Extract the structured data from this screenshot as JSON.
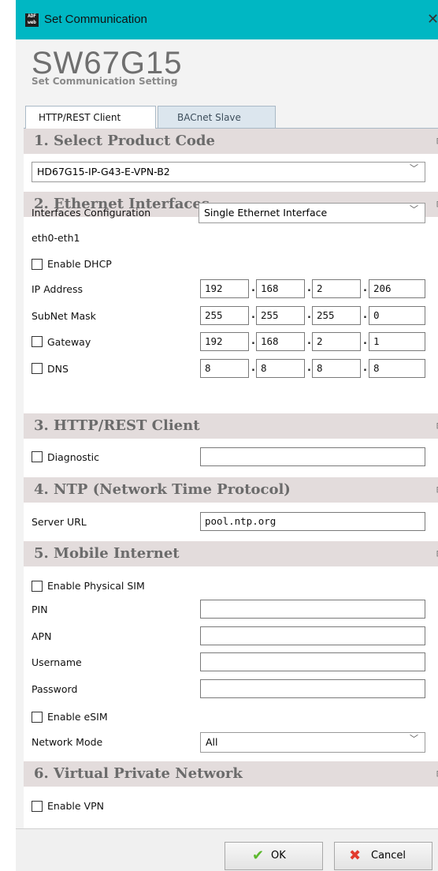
{
  "window": {
    "title": "Set Communication",
    "close_glyph": "✕",
    "app_icon": "ADF web"
  },
  "header": {
    "product_name": "SW67G15",
    "subtitle": "Set Communication Setting"
  },
  "tabs": [
    {
      "label": "HTTP/REST Client",
      "active": true
    },
    {
      "label": "BACnet Slave",
      "active": false
    }
  ],
  "sections": {
    "product_code": {
      "title": "1. Select Product Code",
      "selected": "HD67G15-IP-G43-E-VPN-B2"
    },
    "ethernet": {
      "title": "2. Ethernet Interfaces",
      "interfaces_label": "Interfaces Configuration",
      "interfaces_value": "Single Ethernet Interface",
      "group_label": "eth0-eth1",
      "dhcp_label": "Enable DHCP",
      "dhcp_checked": false,
      "ip_label": "IP Address",
      "ip": [
        "192",
        "168",
        "2",
        "206"
      ],
      "mask_label": "SubNet Mask",
      "mask": [
        "255",
        "255",
        "255",
        "0"
      ],
      "gateway_label": "Gateway",
      "gateway_checked": false,
      "gateway": [
        "192",
        "168",
        "2",
        "1"
      ],
      "dns_label": "DNS",
      "dns_checked": false,
      "dns": [
        "8",
        "8",
        "8",
        "8"
      ]
    },
    "http": {
      "title": "3. HTTP/REST Client",
      "diagnostic_label": "Diagnostic",
      "diagnostic_checked": false,
      "diagnostic_value": ""
    },
    "ntp": {
      "title": "4. NTP (Network Time Protocol)",
      "server_label": "Server URL",
      "server_value": "pool.ntp.org"
    },
    "mobile": {
      "title": "5. Mobile Internet",
      "physical_sim_label": "Enable Physical SIM",
      "physical_sim_checked": false,
      "pin_label": "PIN",
      "pin_value": "",
      "apn_label": "APN",
      "apn_value": "",
      "username_label": "Username",
      "username_value": "",
      "password_label": "Password",
      "password_value": "",
      "esim_label": "Enable eSIM",
      "esim_checked": false,
      "network_mode_label": "Network Mode",
      "network_mode_value": "All"
    },
    "vpn": {
      "title": "6. Virtual Private Network",
      "enable_label": "Enable VPN",
      "enable_checked": false
    }
  },
  "collapse_glyph": "⊟",
  "chevron_glyph": "﹀",
  "ip_separator": ".",
  "buttons": {
    "ok_label": "OK",
    "ok_icon_color": "#5cb82e",
    "cancel_label": "Cancel",
    "cancel_icon_color": "#e23b2e"
  },
  "colors": {
    "titlebar": "#00b7c3",
    "section_header_bg": "#e3dcdc",
    "section_header_text": "#6b6b6b"
  }
}
